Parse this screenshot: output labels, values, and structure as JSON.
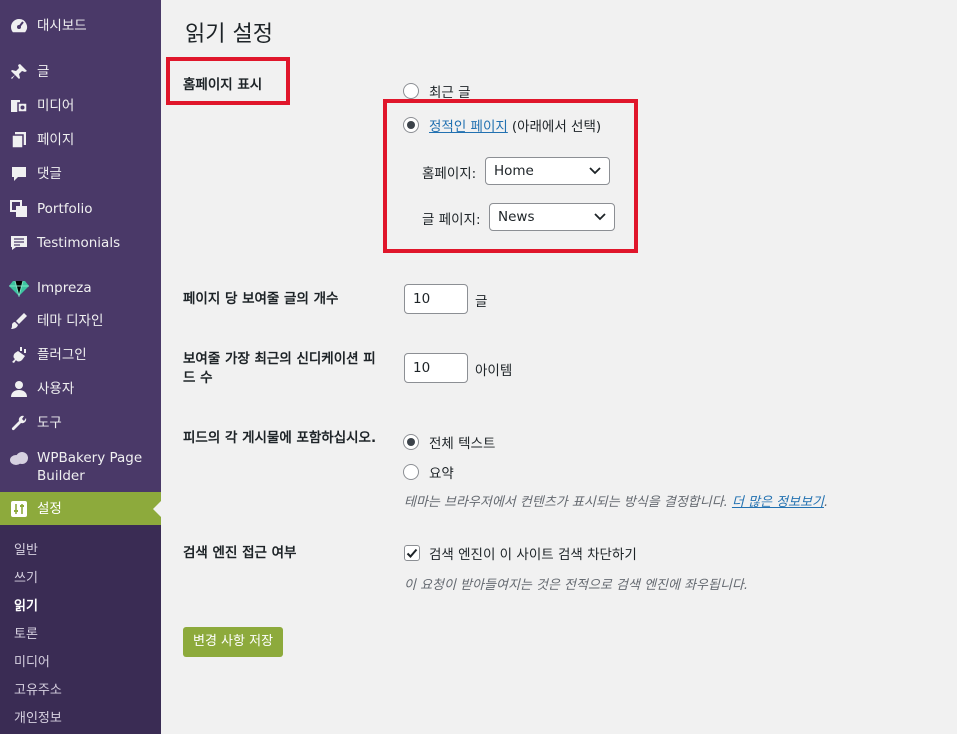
{
  "sidebar": {
    "items": [
      {
        "label": "대시보드",
        "icon": "dashboard-icon"
      },
      {
        "label": "글",
        "icon": "pin-icon"
      },
      {
        "label": "미디어",
        "icon": "media-icon"
      },
      {
        "label": "페이지",
        "icon": "page-icon"
      },
      {
        "label": "댓글",
        "icon": "comment-icon"
      },
      {
        "label": "Portfolio",
        "icon": "portfolio-icon"
      },
      {
        "label": "Testimonials",
        "icon": "testimonials-icon"
      },
      {
        "label": "Impreza",
        "icon": "diamond-icon"
      },
      {
        "label": "테마 디자인",
        "icon": "brush-icon"
      },
      {
        "label": "플러그인",
        "icon": "plugin-icon"
      },
      {
        "label": "사용자",
        "icon": "user-icon"
      },
      {
        "label": "도구",
        "icon": "wrench-icon"
      },
      {
        "label": "WPBakery Page Builder",
        "icon": "cloud-icon"
      },
      {
        "label": "설정",
        "icon": "settings-icon"
      }
    ],
    "submenu": [
      "일반",
      "쓰기",
      "읽기",
      "토론",
      "미디어",
      "고유주소",
      "개인정보"
    ],
    "current_submenu": "읽기",
    "accent": "#8daa3c"
  },
  "page": {
    "title": "읽기 설정",
    "homepage_display": {
      "label": "홈페이지 표시",
      "option_latest": "최근 글",
      "option_static_link": "정적인 페이지",
      "option_static_suffix": "(아래에서 선택)",
      "selected": "static",
      "homepage_label": "홈페이지:",
      "homepage_value": "Home",
      "posts_page_label": "글 페이지:",
      "posts_page_value": "News"
    },
    "posts_per_page": {
      "label": "페이지 당 보여줄 글의 개수",
      "value": "10",
      "unit": "글"
    },
    "syndication": {
      "label": "보여줄 가장 최근의 신디케이션 피드 수",
      "value": "10",
      "unit": "아이템"
    },
    "feed_content": {
      "label": "피드의 각 게시물에 포함하십시오.",
      "option_full": "전체 텍스트",
      "option_summary": "요약",
      "selected": "full",
      "desc": "테마는 브라우저에서 컨텐츠가 표시되는 방식을 결정합니다.",
      "desc_link": "더 많은 정보보기",
      "desc_end": "."
    },
    "search_visibility": {
      "label": "검색 엔진 접근 여부",
      "checkbox_label": "검색 엔진이 이 사이트 검색 차단하기",
      "checked": true,
      "desc": "이 요청이 받아들여지는 것은 전적으로 검색 엔진에 좌우됩니다."
    },
    "save_label": "변경 사항 저장",
    "highlight_color": "#e0162b"
  }
}
